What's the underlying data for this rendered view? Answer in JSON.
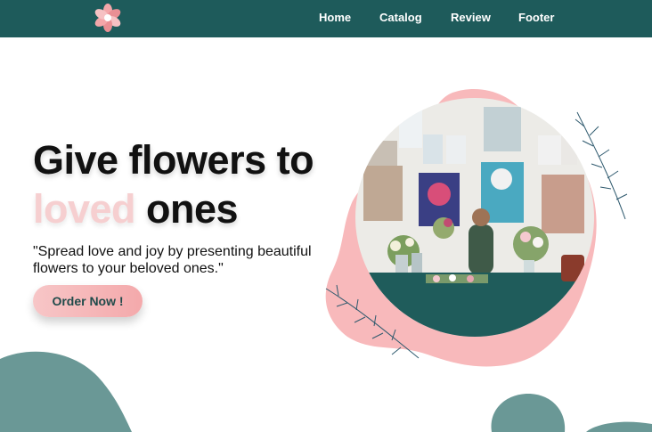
{
  "nav": {
    "items": [
      {
        "label": "Home"
      },
      {
        "label": "Catalog"
      },
      {
        "label": "Review"
      },
      {
        "label": "Footer"
      }
    ]
  },
  "hero": {
    "title_line1": "Give flowers to",
    "title_loved": "loved",
    "title_ones": " ones",
    "subtitle": "\"Spread love and joy by presenting beautiful flowers to your beloved ones.\"",
    "cta_label": "Order Now !"
  },
  "colors": {
    "topbar": "#1e5b5b",
    "accent_pink": "#f8b9bb",
    "teal_blob": "#6a9896"
  },
  "icons": [
    "flower-logo-icon",
    "leaf-branch-icon"
  ]
}
